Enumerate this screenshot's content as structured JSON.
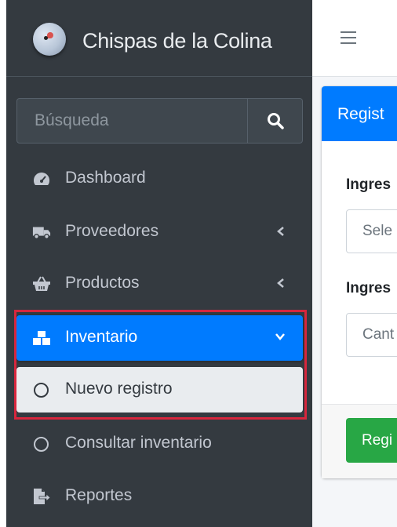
{
  "brand": {
    "name": "Chispas de la Colina"
  },
  "search": {
    "placeholder": "Búsqueda"
  },
  "sidebar": {
    "items": [
      {
        "label": "Dashboard"
      },
      {
        "label": "Proveedores"
      },
      {
        "label": "Productos"
      },
      {
        "label": "Inventario"
      },
      {
        "label": "Nuevo registro"
      },
      {
        "label": "Consultar inventario"
      },
      {
        "label": "Reportes"
      }
    ]
  },
  "main": {
    "card_title": "Regist",
    "field1_label": "Ingres",
    "field1_placeholder": "Sele",
    "field2_label": "Ingres",
    "field2_placeholder": "Cant",
    "submit_label": "Regi"
  },
  "colors": {
    "sidebar_bg": "#343a40",
    "active": "#007bff",
    "submit": "#28a745",
    "highlight": "#d7263d"
  }
}
